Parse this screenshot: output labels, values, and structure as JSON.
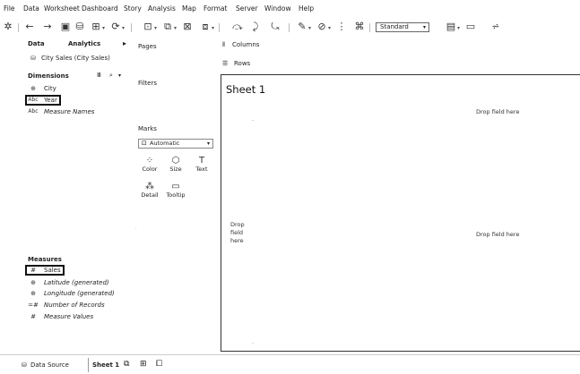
{
  "menu": [
    "File",
    "Data",
    "Worksheet",
    "Dashboard",
    "Story",
    "Analysis",
    "Map",
    "Format",
    "Server",
    "Window",
    "Help"
  ],
  "toolbar": {
    "icons": [
      "tableau-logo-icon",
      "undo-icon",
      "redo-icon",
      "save-icon",
      "new-data-source-icon",
      "new-worksheet-icon",
      "refresh-icon",
      "run-update-icon",
      "duplicate-icon",
      "clear-sheet-icon",
      "swap-icon",
      "sort-ascending-icon",
      "sort-descending-icon",
      "highlight-icon",
      "group-icon",
      "label-icon",
      "fix-axes-icon",
      "show-me-icon",
      "presentation-icon",
      "share-icon"
    ],
    "fit_selected": "Standard"
  },
  "data_pane": {
    "tab_data": "Data",
    "tab_analytics": "Analytics",
    "data_source": "City Sales (City Sales)",
    "dimensions_header": "Dimensions",
    "dimensions": [
      {
        "icon": "⊕",
        "name": "City",
        "highlighted": false
      },
      {
        "icon": "Abc",
        "name": "Year",
        "highlighted": true
      },
      {
        "icon": "Abc",
        "name": "Measure Names",
        "highlighted": false
      }
    ],
    "measures_header": "Measures",
    "measures": [
      {
        "icon": "#",
        "name": "Sales",
        "highlighted": true
      },
      {
        "icon": "⊕",
        "name": "Latitude (generated)",
        "highlighted": false
      },
      {
        "icon": "⊕",
        "name": "Longitude (generated)",
        "highlighted": false
      },
      {
        "icon": "=#",
        "name": "Number of Records",
        "highlighted": false
      },
      {
        "icon": "#",
        "name": "Measure Values",
        "highlighted": false
      }
    ]
  },
  "shelves": {
    "pages": "Pages",
    "filters": "Filters",
    "marks": "Marks",
    "marks_type": "Automatic",
    "columns": "Columns",
    "rows": "Rows",
    "mark_buttons": [
      {
        "label": "Color",
        "icon": "⁘"
      },
      {
        "label": "Size",
        "icon": "⬡"
      },
      {
        "label": "Text",
        "icon": "T"
      },
      {
        "label": "Detail",
        "icon": "⁂"
      },
      {
        "label": "Tooltip",
        "icon": "▭"
      }
    ]
  },
  "canvas": {
    "sheet_title": "Sheet 1",
    "drop_top": "Drop field here",
    "drop_right": "Drop field here",
    "drop_left_lines": [
      "Drop",
      "field",
      "here"
    ]
  },
  "tabs": {
    "data_source": "Data Source",
    "sheet": "Sheet 1"
  }
}
